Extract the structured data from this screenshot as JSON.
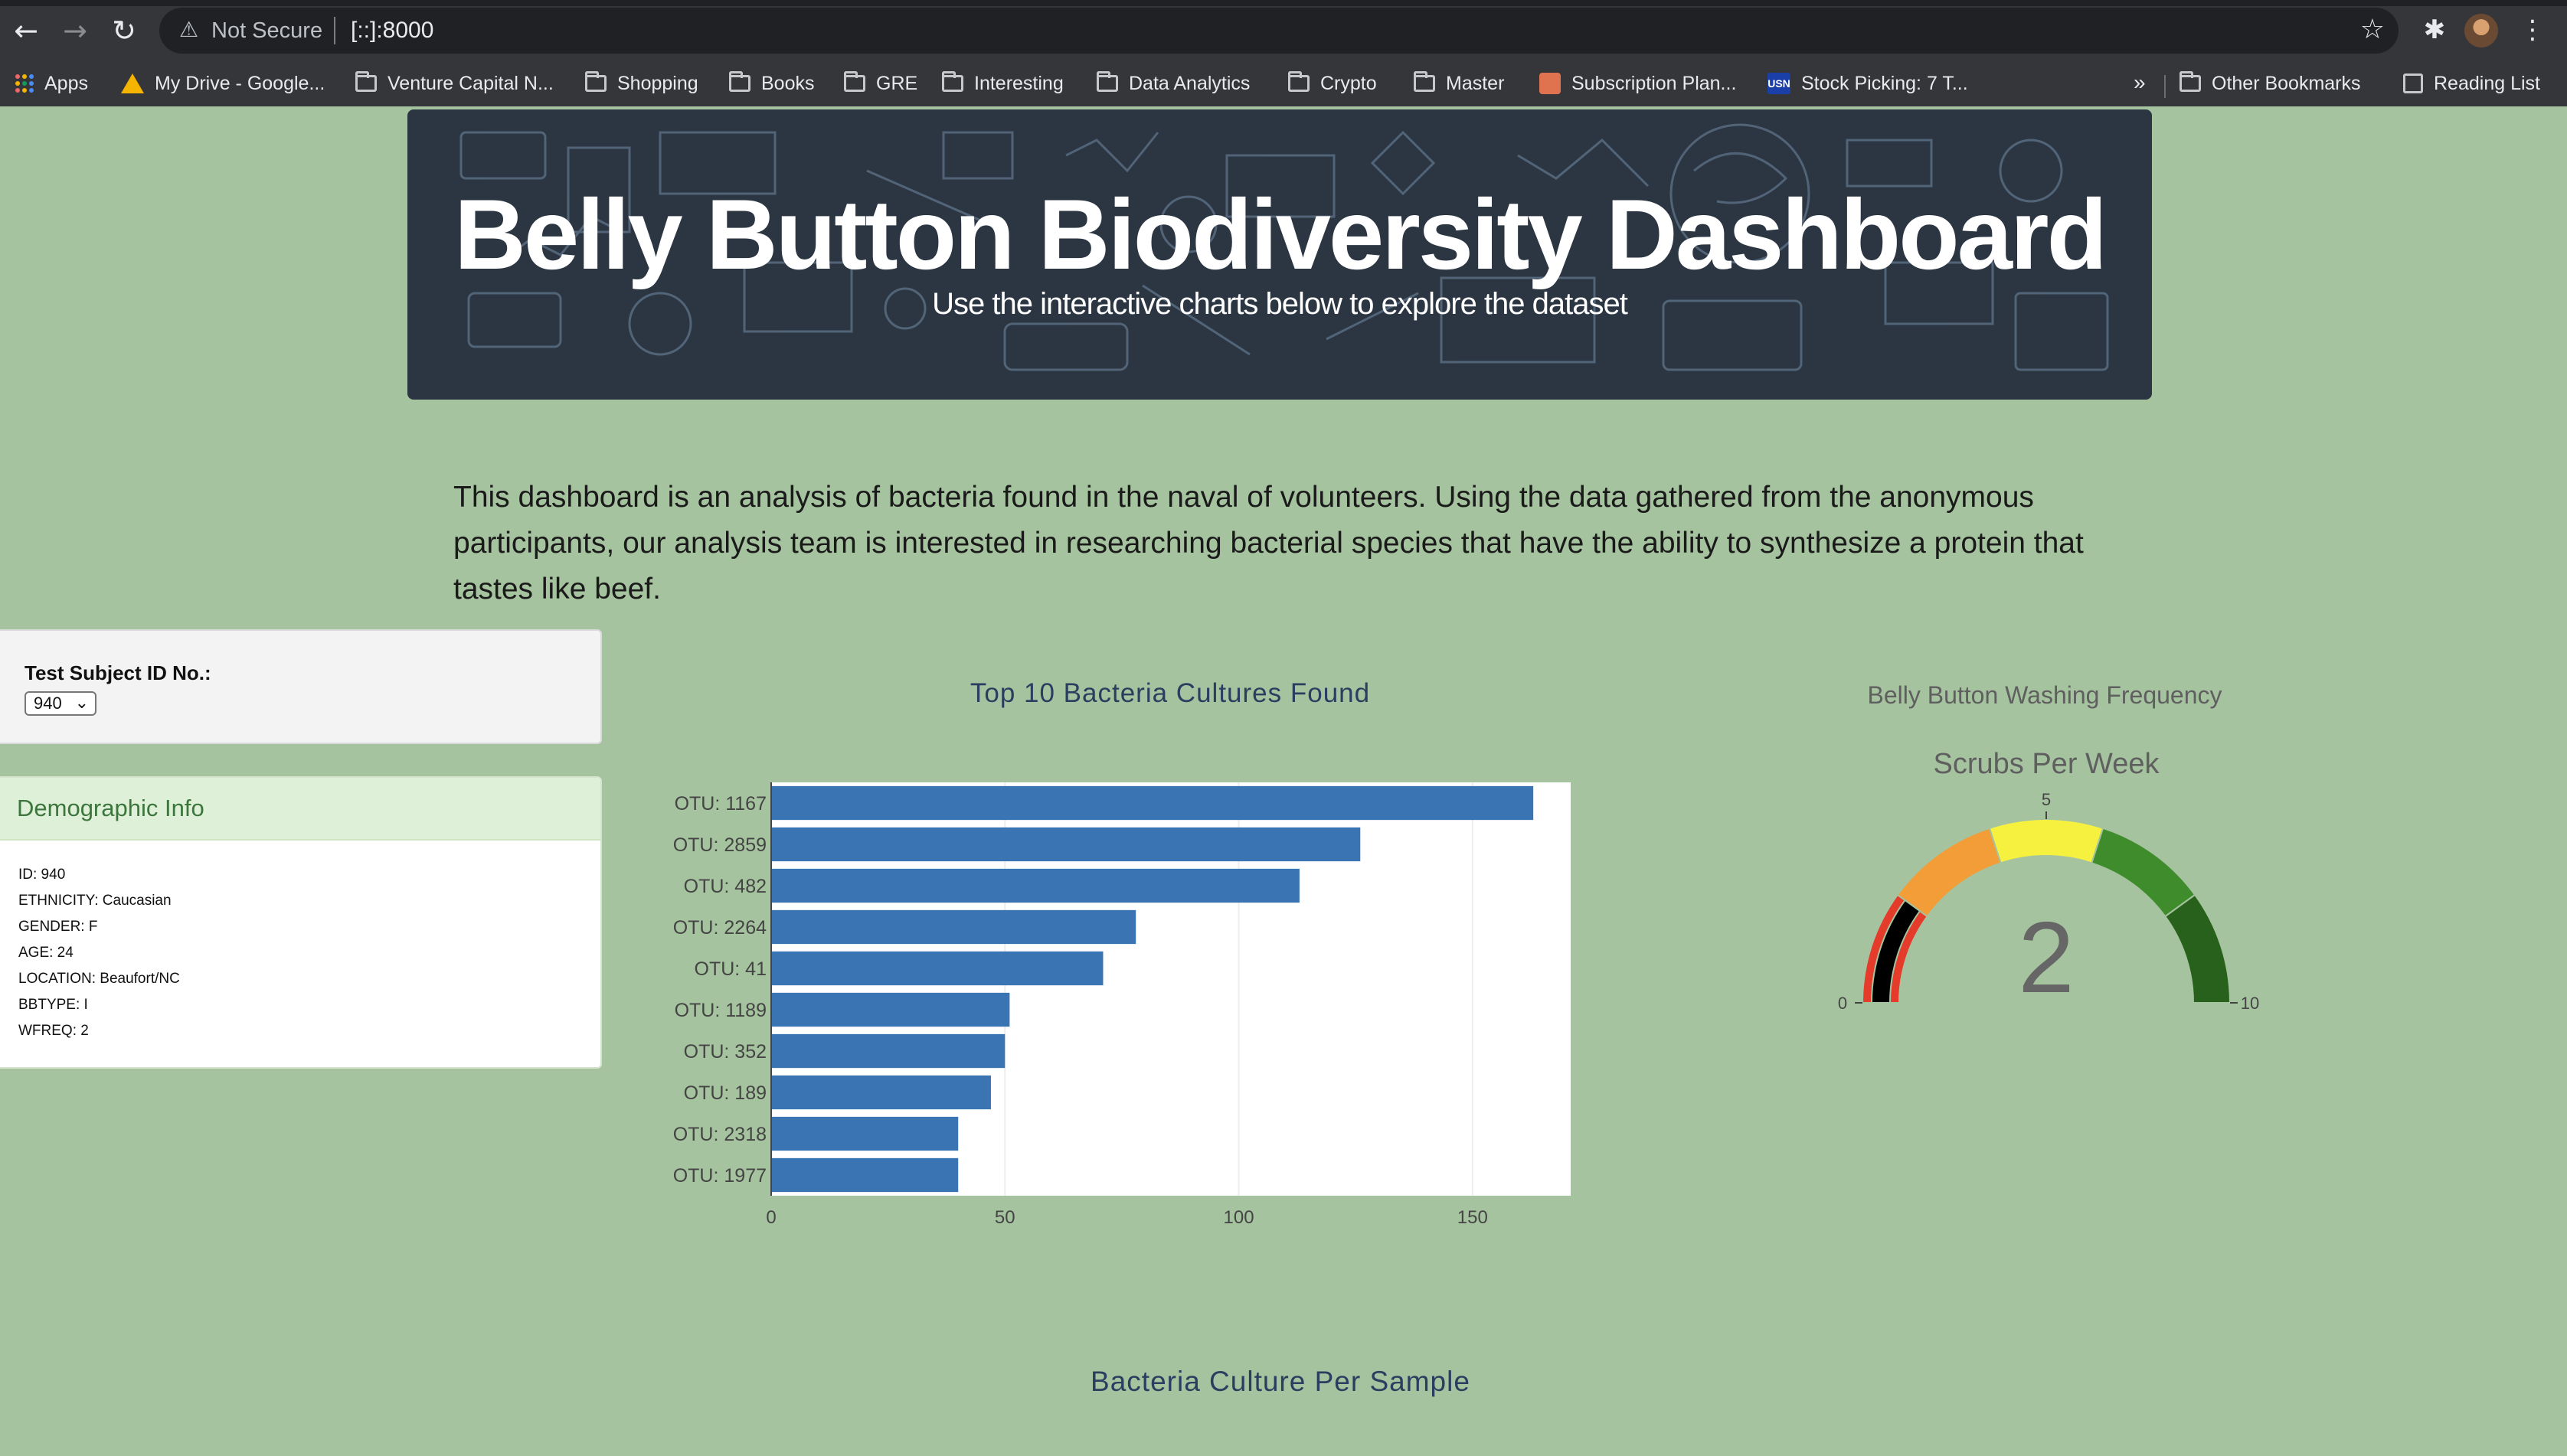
{
  "browser": {
    "security_label": "Not Secure",
    "url": "[::]:8000",
    "bookmarks": [
      {
        "label": "Apps",
        "icon": "apps-grid-icon"
      },
      {
        "label": "My Drive - Google...",
        "icon": "google-drive-icon"
      },
      {
        "label": "Venture Capital N...",
        "icon": "folder-icon"
      },
      {
        "label": "Shopping",
        "icon": "folder-icon"
      },
      {
        "label": "Books",
        "icon": "folder-icon"
      },
      {
        "label": "GRE",
        "icon": "folder-icon"
      },
      {
        "label": "Interesting",
        "icon": "folder-icon"
      },
      {
        "label": "Data Analytics",
        "icon": "folder-icon"
      },
      {
        "label": "Crypto",
        "icon": "folder-icon"
      },
      {
        "label": "Master",
        "icon": "folder-icon"
      },
      {
        "label": "Subscription Plan...",
        "icon": "subscription-icon"
      },
      {
        "label": "Stock Picking: 7 T...",
        "icon": "usn-icon"
      }
    ],
    "more_label": "»",
    "other_bookmarks": "Other Bookmarks",
    "reading_list": "Reading List"
  },
  "header": {
    "title": "Belly Button Biodiversity Dashboard",
    "subtitle": "Use the interactive charts below to explore the dataset"
  },
  "intro": "This dashboard is an analysis of bacteria found in the naval of volunteers. Using the data gathered from the anonymous participants, our analysis team is interested in researching bacterial species that have the ability to synthesize a protein that tastes like beef.",
  "selector": {
    "label": "Test Subject ID No.:",
    "selected": "940"
  },
  "demographics": {
    "heading": "Demographic Info",
    "rows": [
      "ID: 940",
      "ETHNICITY: Caucasian",
      "GENDER: F",
      "AGE: 24",
      "LOCATION: Beaufort/NC",
      "BBTYPE: I",
      "WFREQ: 2"
    ]
  },
  "charts": {
    "bubble_title": "Bacteria Culture Per Sample"
  },
  "colors": {
    "page_bg": "#a6c39f",
    "bar": "#3a74b2",
    "panel_heading_bg": "#dff0d8",
    "panel_heading_text": "#3c763d",
    "gauge_red": "#e53b2a",
    "gauge_orange": "#f29d38",
    "gauge_yellow": "#f6f13f",
    "gauge_green": "#3f8c2c",
    "gauge_darkgreen": "#28611b"
  },
  "chart_data": [
    {
      "type": "bar",
      "orientation": "horizontal",
      "title": "Top 10 Bacteria Cultures Found",
      "categories": [
        "OTU: 1167",
        "OTU: 2859",
        "OTU: 482",
        "OTU: 2264",
        "OTU: 41",
        "OTU: 1189",
        "OTU: 352",
        "OTU: 189",
        "OTU: 2318",
        "OTU: 1977"
      ],
      "values": [
        163,
        126,
        113,
        78,
        71,
        51,
        50,
        47,
        40,
        40
      ],
      "xlim": [
        0,
        171
      ],
      "xticks": [
        0,
        50,
        100,
        150
      ],
      "xlabel": "",
      "ylabel": "",
      "grid": true
    },
    {
      "type": "gauge",
      "title": "Belly Button Washing Frequency",
      "subtitle": "Scrubs Per Week",
      "value": 2,
      "range": [
        0,
        10
      ],
      "tick_labels": [
        "0",
        "5",
        "10"
      ],
      "steps": [
        {
          "range": [
            0,
            2
          ],
          "color": "#e53b2a"
        },
        {
          "range": [
            2,
            4
          ],
          "color": "#f29d38"
        },
        {
          "range": [
            4,
            6
          ],
          "color": "#f6f13f"
        },
        {
          "range": [
            6,
            8
          ],
          "color": "#3f8c2c"
        },
        {
          "range": [
            8,
            10
          ],
          "color": "#28611b"
        }
      ],
      "bar_color": "#000000"
    }
  ]
}
